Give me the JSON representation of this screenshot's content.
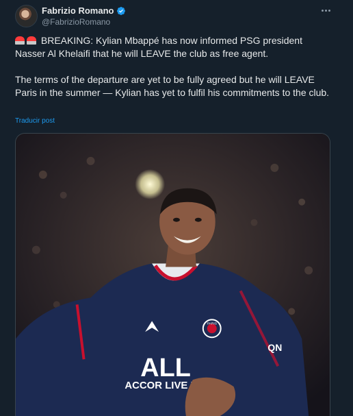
{
  "author": {
    "display_name": "Fabrizio Romano",
    "handle": "@FabrizioRomano",
    "verified": true,
    "avatar_icon": "user-avatar"
  },
  "tweet": {
    "paragraph_1": "BREAKING: Kylian Mbappé has now informed PSG president Nasser Al Khelaifi that he will LEAVE the club as free agent.",
    "paragraph_2": "The terms of the departure are yet to be fully agreed but he will LEAVE Paris in the summer — Kylian has yet to fulfil his commitments to the club.",
    "emoji_prefix": [
      "siren-emoji",
      "siren-emoji"
    ],
    "translate_label": "Traducir post"
  },
  "media": {
    "jersey_text_brand": "ALL",
    "jersey_text_sponsor": "ACCOR LIVE LI",
    "jersey_badge": "PARIS",
    "jersey_sleeve": "QN"
  },
  "colors": {
    "background": "#15202b",
    "accent": "#1d9bf0",
    "text_primary": "#e7e9ea",
    "text_secondary": "#8b98a5"
  }
}
